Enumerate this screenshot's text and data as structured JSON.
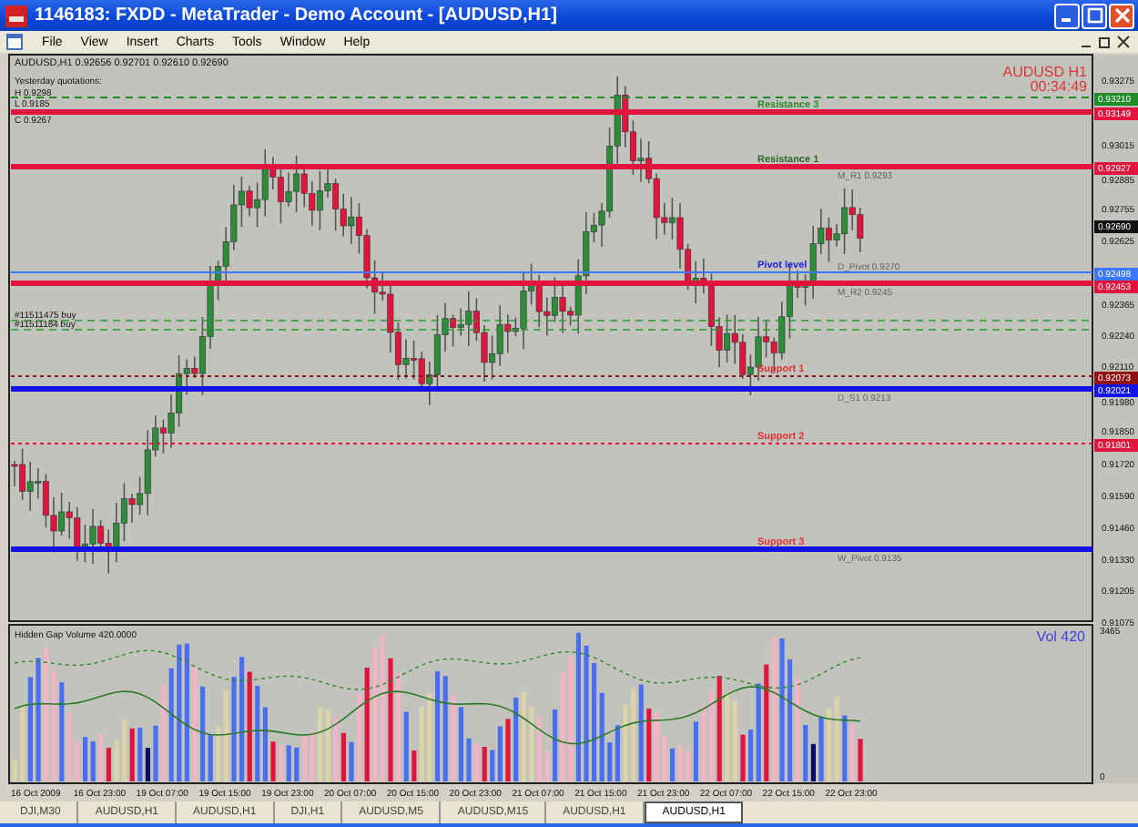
{
  "window": {
    "title": "1146183: FXDD - MetaTrader - Demo Account - [AUDUSD,H1]"
  },
  "menu": [
    "File",
    "View",
    "Insert",
    "Charts",
    "Tools",
    "Window",
    "Help"
  ],
  "chart": {
    "header": "AUDUSD,H1  0.92656 0.92701 0.92610 0.92690",
    "quotations": [
      "Yesterday quotations:",
      "H 0.9298",
      "L 0.9185",
      "C 0.9267"
    ],
    "symbol_label": "AUDUSD  H1",
    "timer": "00:34:49",
    "price_axis": [
      "0.93275",
      "0.93015",
      "0.92885",
      "0.92755",
      "0.92625",
      "0.92365",
      "0.92240",
      "0.92110",
      "0.91980",
      "0.91850",
      "0.91720",
      "0.91590",
      "0.91460",
      "0.91330",
      "0.91205",
      "0.91075"
    ],
    "levels": [
      {
        "kind": "dashed",
        "color": "#1e8c28",
        "tag": "0.93210"
      },
      {
        "kind": "thick",
        "color": "#e0143c",
        "tag": "0.93149",
        "label": {
          "text": "Resistance 3",
          "color": "#2a8a2a"
        }
      },
      {
        "kind": "thick",
        "color": "#e0143c",
        "tag": "0.92927",
        "label": {
          "text": "Resistance 1",
          "color": "#2a6a2a"
        },
        "note": "M_R1 0.9293"
      },
      {
        "kind": "bid",
        "color": "#101010",
        "tag": "0.92690"
      },
      {
        "kind": "thin",
        "color": "#3c78ff",
        "tag": "0.92498",
        "label": {
          "text": "Pivot level",
          "color": "#2020e0"
        },
        "note": "D_Pivot 0.9270"
      },
      {
        "kind": "thick",
        "color": "#e0143c",
        "tag": "0.92453",
        "note": "M_R2 0.9245"
      },
      {
        "kind": "dotted",
        "color": "#901010",
        "tag": "0.92073",
        "label": {
          "text": "Support 1",
          "color": "#e03030"
        }
      },
      {
        "kind": "thick",
        "color": "#1414e6",
        "tag": "0.92021",
        "note": "D_S1 0.9213"
      },
      {
        "kind": "dotted",
        "color": "#e0143c",
        "tag": "0.91801",
        "label": {
          "text": "Support 2",
          "color": "#e03030"
        }
      },
      {
        "kind": "thick",
        "color": "#1414e6",
        "label": {
          "text": "Support 3",
          "color": "#e03030"
        },
        "note": "W_Pivot 0.9135"
      }
    ],
    "orders": [
      "#11511475 buy",
      "#11511184 buy"
    ],
    "indicator": {
      "title": "Hidden Gap Volume 420.0000",
      "reading": "Vol  420",
      "axis": [
        "3465",
        "0"
      ]
    },
    "time_axis": [
      "16 Oct 2009",
      "16 Oct 23:00",
      "19 Oct 07:00",
      "19 Oct 15:00",
      "19 Oct 23:00",
      "20 Oct 07:00",
      "20 Oct 15:00",
      "20 Oct 23:00",
      "21 Oct 07:00",
      "21 Oct 15:00",
      "21 Oct 23:00",
      "22 Oct 07:00",
      "22 Oct 15:00",
      "22 Oct 23:00"
    ]
  },
  "tabs": [
    {
      "label": "DJI,M30",
      "selected": false
    },
    {
      "label": "AUDUSD,H1",
      "selected": false
    },
    {
      "label": "AUDUSD,H1",
      "selected": false
    },
    {
      "label": "DJI,H1",
      "selected": false
    },
    {
      "label": "AUDUSD,M5",
      "selected": false
    },
    {
      "label": "AUDUSD,M15",
      "selected": false
    },
    {
      "label": "AUDUSD,H1",
      "selected": false
    },
    {
      "label": "AUDUSD,H1",
      "selected": true
    }
  ]
}
